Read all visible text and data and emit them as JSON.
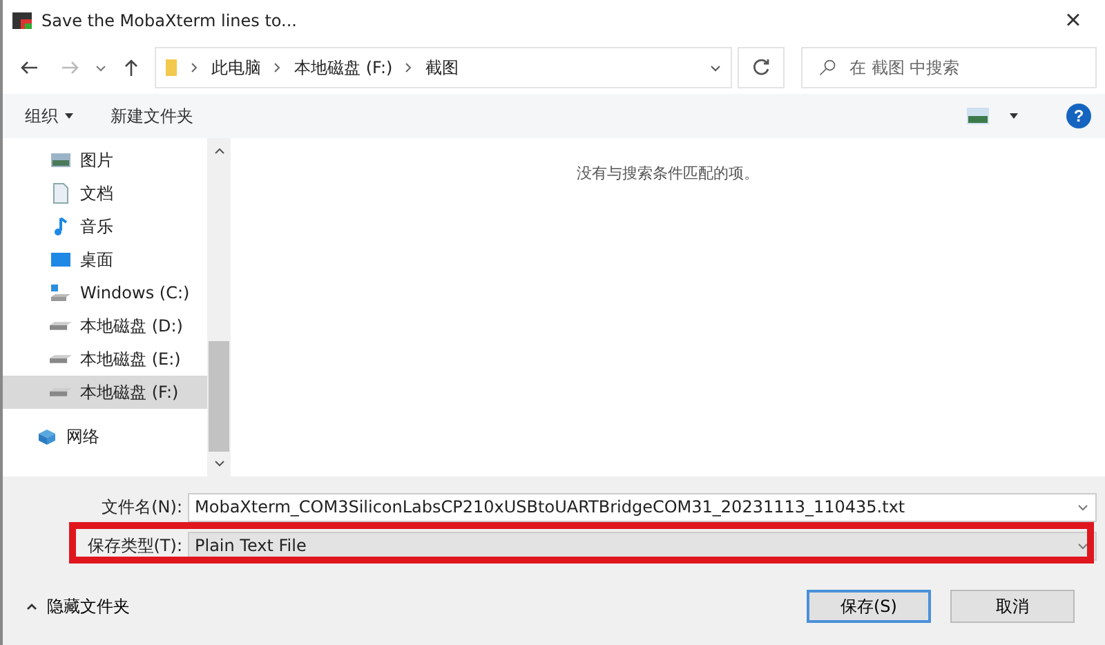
{
  "window": {
    "title": "Save the MobaXterm lines to...",
    "close": "×"
  },
  "address": {
    "path": [
      "此电脑",
      "本地磁盘 (F:)",
      "截图"
    ],
    "search_placeholder": "在 截图 中搜索"
  },
  "toolbar": {
    "organize": "组织",
    "new_folder": "新建文件夹",
    "help": "?"
  },
  "sidebar": {
    "items": [
      {
        "label": "图片",
        "kind": "pictures",
        "selected": false
      },
      {
        "label": "文档",
        "kind": "documents",
        "selected": false
      },
      {
        "label": "音乐",
        "kind": "music",
        "selected": false
      },
      {
        "label": "桌面",
        "kind": "desktop",
        "selected": false
      },
      {
        "label": "Windows (C:)",
        "kind": "system-drive",
        "selected": false
      },
      {
        "label": "本地磁盘 (D:)",
        "kind": "drive",
        "selected": false
      },
      {
        "label": "本地磁盘 (E:)",
        "kind": "drive",
        "selected": false
      },
      {
        "label": "本地磁盘 (F:)",
        "kind": "drive",
        "selected": true
      },
      {
        "label": "网络",
        "kind": "network",
        "selected": false
      }
    ]
  },
  "content": {
    "empty_message": "没有与搜索条件匹配的项。"
  },
  "form": {
    "filename_label": "文件名(N):",
    "filename": "MobaXterm_COM3SiliconLabsCP210xUSBtoUARTBridgeCOM31_20231113_110435.txt",
    "type_label": "保存类型(T):",
    "type": "Plain Text File",
    "type_highlighted": true
  },
  "footer": {
    "hide_folders": "隐藏文件夹",
    "save": "保存(S)",
    "cancel": "取消"
  }
}
